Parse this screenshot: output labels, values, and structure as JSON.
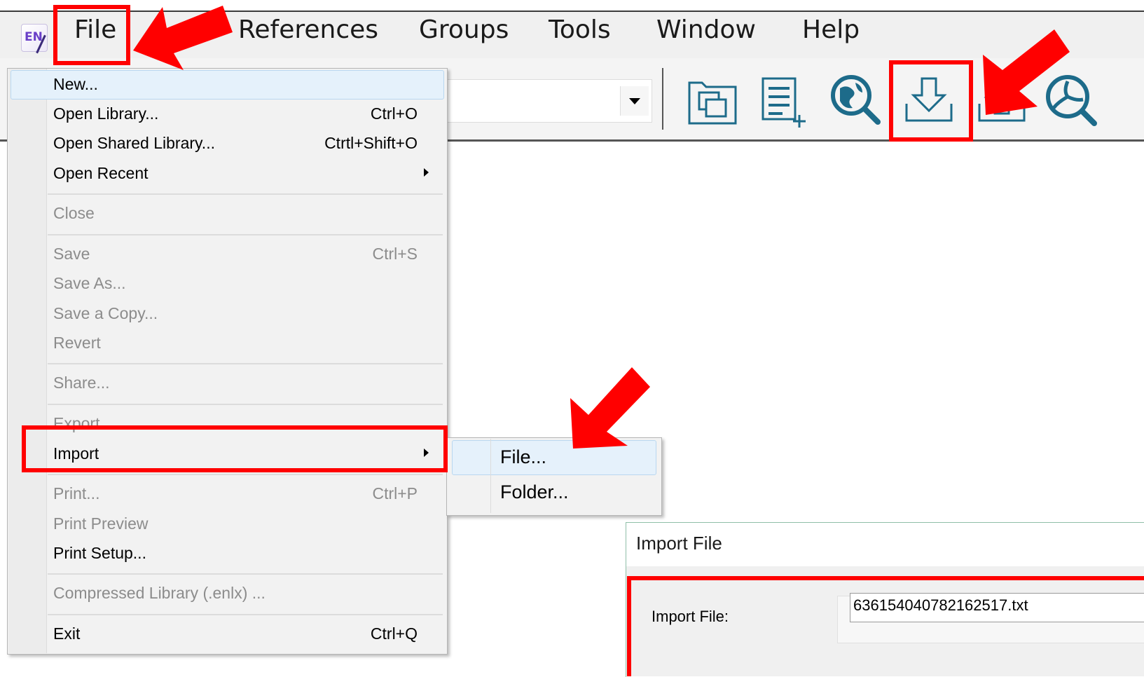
{
  "menubar": {
    "app_icon_text": "EN",
    "items": [
      "File",
      "References",
      "Groups",
      "Tools",
      "Window",
      "Help"
    ]
  },
  "toolbar": {
    "icons": [
      "copy-library-icon",
      "new-reference-icon",
      "online-search-icon",
      "import-icon",
      "export-icon",
      "find-full-text-icon"
    ],
    "accent_color": "#1d6b8a"
  },
  "file_menu": {
    "items": [
      {
        "label": "New...",
        "shortcut": "",
        "enabled": true,
        "submenu": false
      },
      {
        "label": "Open Library...",
        "shortcut": "Ctrl+O",
        "enabled": true,
        "submenu": false
      },
      {
        "label": "Open Shared Library...",
        "shortcut": "Ctrtl+Shift+O",
        "enabled": true,
        "submenu": false
      },
      {
        "label": "Open Recent",
        "shortcut": "",
        "enabled": true,
        "submenu": true
      },
      {
        "label": "Close",
        "shortcut": "",
        "enabled": false,
        "submenu": false
      },
      {
        "label": "Save",
        "shortcut": "Ctrl+S",
        "enabled": false,
        "submenu": false
      },
      {
        "label": "Save As...",
        "shortcut": "",
        "enabled": false,
        "submenu": false
      },
      {
        "label": "Save a Copy...",
        "shortcut": "",
        "enabled": false,
        "submenu": false
      },
      {
        "label": "Revert",
        "shortcut": "",
        "enabled": false,
        "submenu": false
      },
      {
        "label": "Share...",
        "shortcut": "",
        "enabled": false,
        "submenu": false
      },
      {
        "label": "Export...",
        "shortcut": "",
        "enabled": false,
        "submenu": false
      },
      {
        "label": "Import",
        "shortcut": "",
        "enabled": true,
        "submenu": true
      },
      {
        "label": "Print...",
        "shortcut": "Ctrl+P",
        "enabled": false,
        "submenu": false
      },
      {
        "label": "Print Preview",
        "shortcut": "",
        "enabled": false,
        "submenu": false
      },
      {
        "label": "Print Setup...",
        "shortcut": "",
        "enabled": true,
        "submenu": false
      },
      {
        "label": "Compressed Library (.enlx) ...",
        "shortcut": "",
        "enabled": false,
        "submenu": false
      },
      {
        "label": "Exit",
        "shortcut": "Ctrl+Q",
        "enabled": true,
        "submenu": false
      }
    ]
  },
  "import_submenu": {
    "items": [
      "File...",
      "Folder..."
    ]
  },
  "import_dialog": {
    "title": "Import File",
    "field_label": "Import File:",
    "field_value": "636154040782162517.txt"
  },
  "annotation_color": "#ff0000"
}
